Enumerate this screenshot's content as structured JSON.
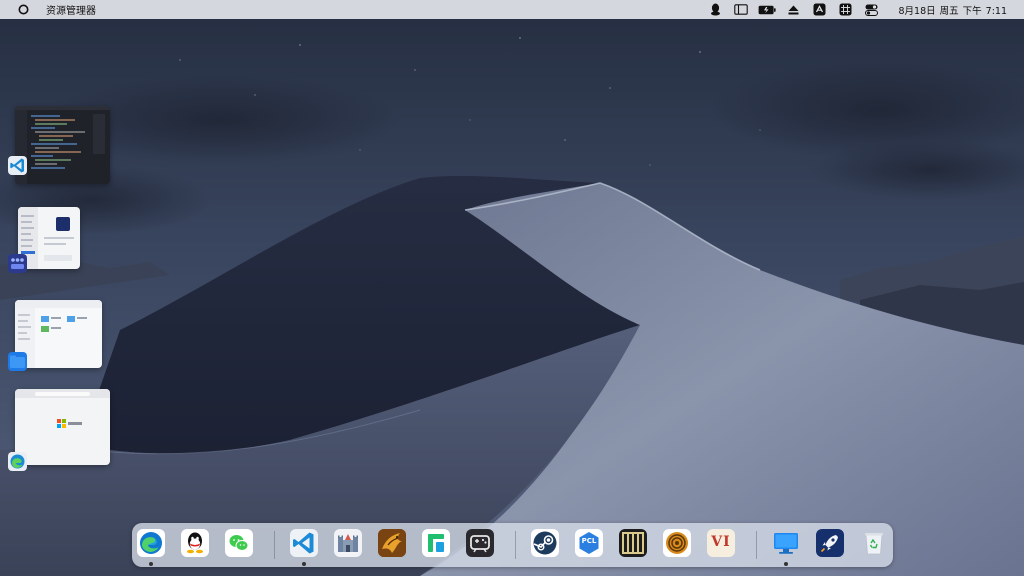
{
  "menubar": {
    "app_name": "资源管理器",
    "tray_icons": [
      "qq-tray-icon",
      "panel-icon",
      "battery-icon",
      "eject-icon",
      "app-tray-icon",
      "grid-icon",
      "control-center-icon"
    ],
    "clock": {
      "date": "8月18日",
      "weekday": "周五",
      "ampm": "下午",
      "time": "7:11"
    }
  },
  "minimized_windows": [
    {
      "name": "vscode-window",
      "app_icon": "vscode-icon"
    },
    {
      "name": "settings-window",
      "app_icon": "app-store-icon"
    },
    {
      "name": "file-explorer-window",
      "app_icon": "folder-icon"
    },
    {
      "name": "edge-window",
      "app_icon": "edge-icon"
    }
  ],
  "dock": {
    "groups": [
      [
        "edge-icon",
        "qq-icon",
        "wechat-icon"
      ],
      [
        "vscode-icon",
        "castle-icon",
        "dragon-game-icon",
        "green-app-icon",
        "game-controller-icon"
      ],
      [
        "steam-icon",
        "pcl-icon",
        "minecraft-icon",
        "ring-icon",
        "vi-icon"
      ],
      [
        "finder-icon",
        "launchpad-icon",
        "recycle-bin-icon"
      ]
    ],
    "pcl_label": "PCL",
    "vi_label": "VI",
    "running": [
      "edge-icon",
      "vscode-icon",
      "finder-icon"
    ]
  },
  "colors": {
    "sky_top": "#2b3445",
    "sky_bottom": "#4d5a74",
    "dune_light": "#8791a8",
    "dune_dark": "#1f2538",
    "menubar_bg": "#e2e4e9",
    "dock_bg": "#d6dce8"
  }
}
